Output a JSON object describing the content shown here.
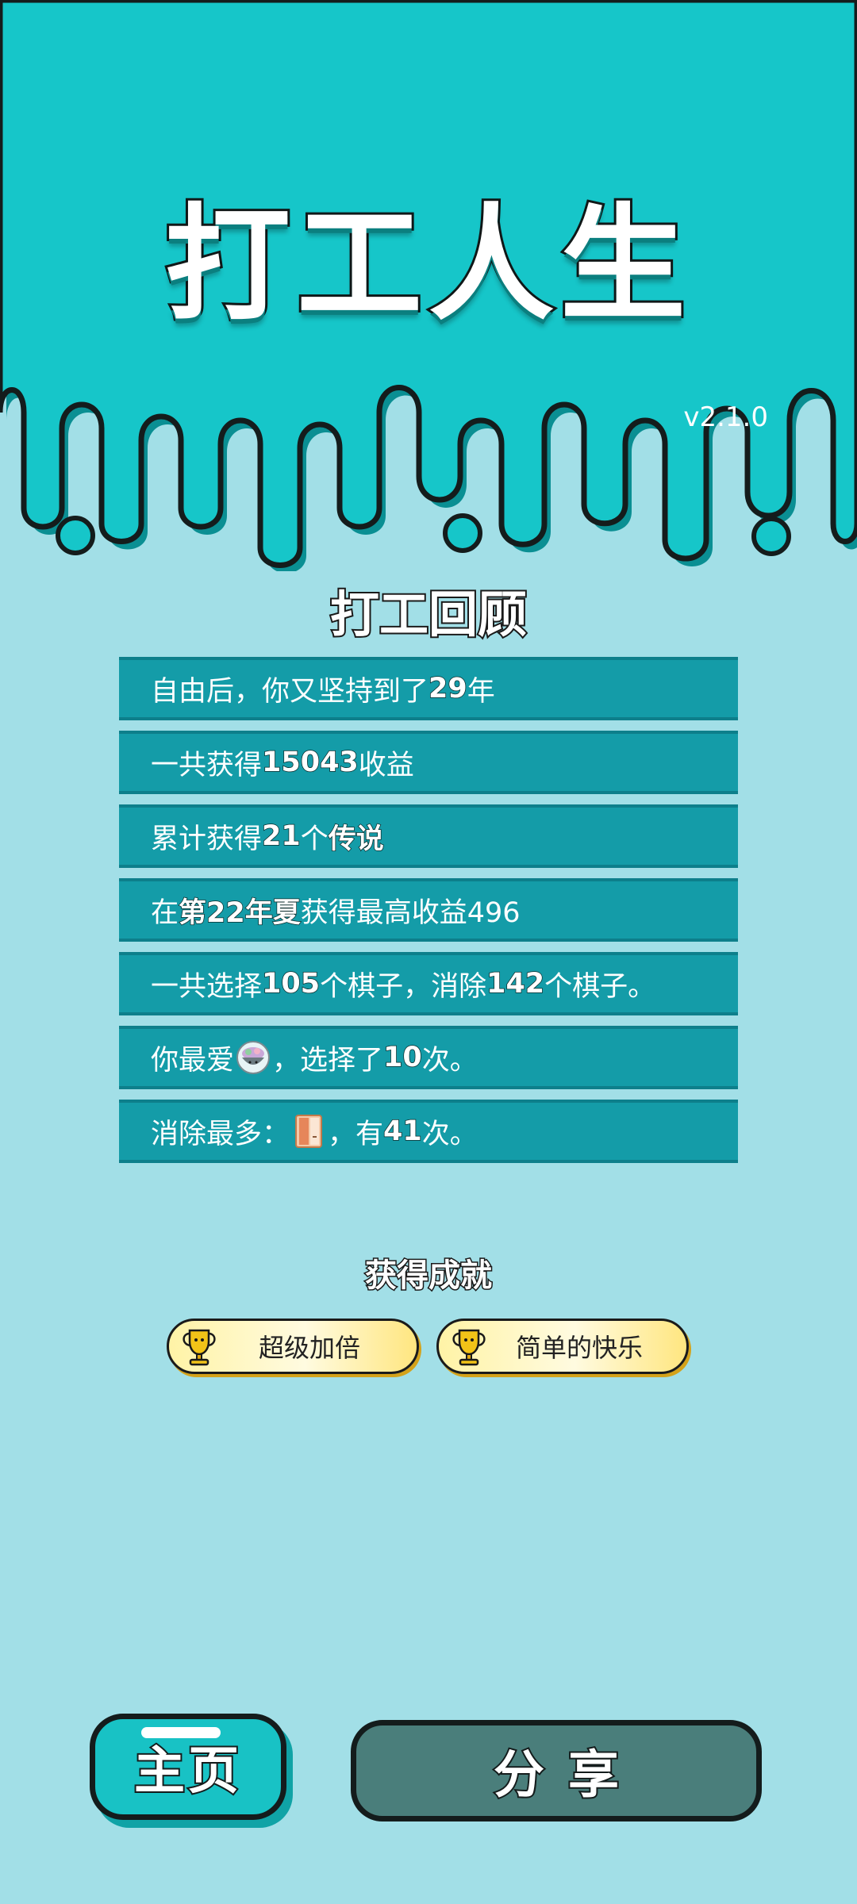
{
  "header": {
    "game_title": "打工人生",
    "version": "v2.1.0"
  },
  "review": {
    "title": "打工回顾",
    "row1": {
      "a": "自由后，你又坚持到了",
      "b": "29",
      "c": "年"
    },
    "row2": {
      "a": "一共获得",
      "b": "15043",
      "c": "收益"
    },
    "row3": {
      "a": "累计获得",
      "b": "21",
      "c": "个",
      "d": "传说"
    },
    "row4": {
      "a": "在 ",
      "b": "第22年夏",
      "c": " 获得最高收益496"
    },
    "row5": {
      "a": "一共选择",
      "b": "105",
      "c": "个棋子，消除",
      "d": "142",
      "e": "个棋子。"
    },
    "row6": {
      "a": "你最爱",
      "b": "，选择了",
      "c": "10",
      "d": "次。",
      "icon": "rock-bowl-icon"
    },
    "row7": {
      "a": "消除最多：",
      "b": "，有",
      "c": "41",
      "d": "次。",
      "icon": "door-icon"
    }
  },
  "achievements": {
    "title": "获得成就",
    "items": [
      {
        "label": "超级加倍",
        "icon": "trophy-icon"
      },
      {
        "label": "简单的快乐",
        "icon": "trophy-icon"
      }
    ]
  },
  "buttons": {
    "home": "主页",
    "share": "分享"
  },
  "colors": {
    "top_background": "#16c6c9",
    "page_background": "#a2dfe7",
    "stat_row": "#149ca8",
    "share_button": "#4a7e7b",
    "home_button": "#18c2c5"
  }
}
